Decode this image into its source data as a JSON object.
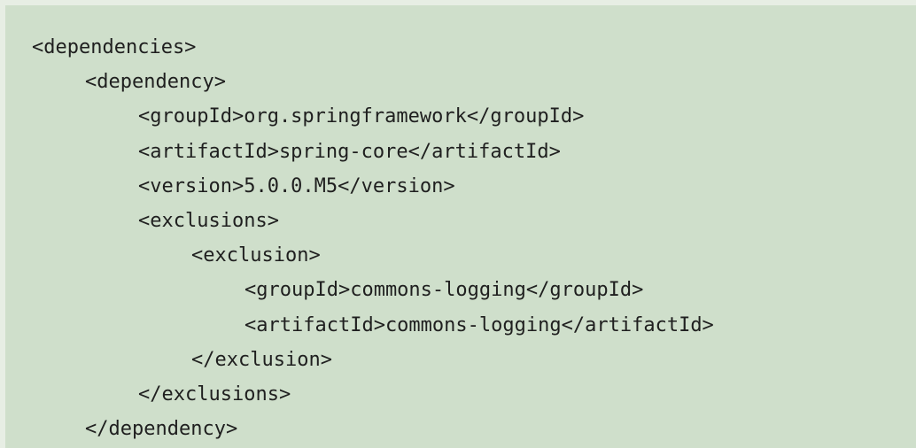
{
  "code": {
    "lines": [
      "<dependencies>",
      "<dependency>",
      "<groupId>org.springframework</groupId>",
      "<artifactId>spring-core</artifactId>",
      "<version>5.0.0.M5</version>",
      "<exclusions>",
      "<exclusion>",
      "<groupId>commons-logging</groupId>",
      "<artifactId>commons-logging</artifactId>",
      "</exclusion>",
      "</exclusions>",
      "</dependency>"
    ]
  },
  "colors": {
    "block_background": "#cfdfcb",
    "page_background": "#e7eee4",
    "text": "#1f1f1f"
  }
}
